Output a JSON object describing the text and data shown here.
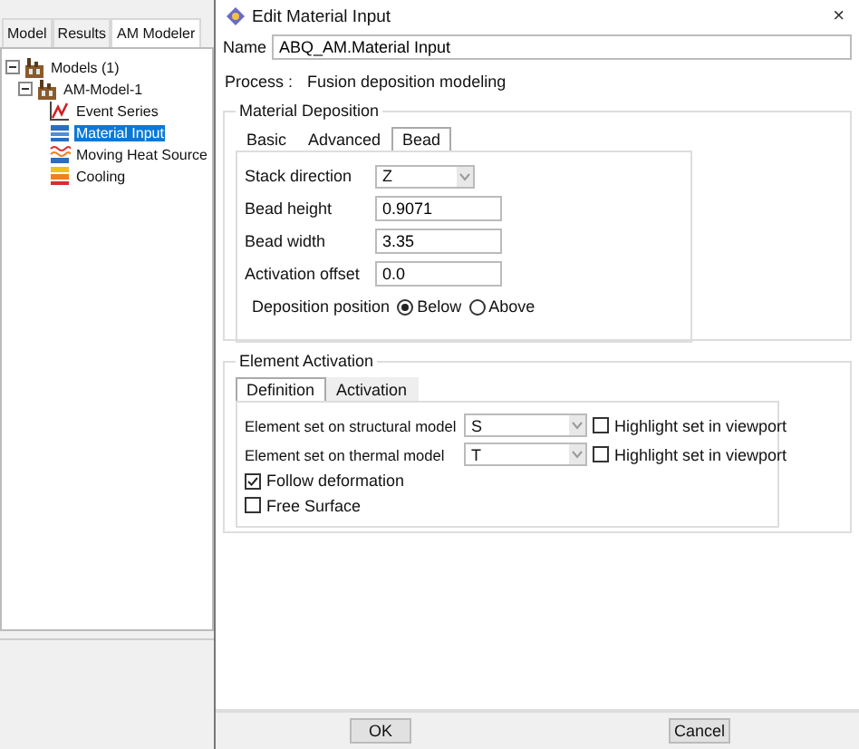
{
  "left_panel": {
    "tabs": [
      {
        "label": "Model",
        "selected": false
      },
      {
        "label": "Results",
        "selected": false
      },
      {
        "label": "AM Modeler",
        "selected": true
      }
    ],
    "tree": [
      {
        "label": "Models (1)",
        "kind": "models",
        "expanded": true,
        "selected": false,
        "children": [
          {
            "label": "AM-Model-1",
            "kind": "model",
            "expanded": true,
            "selected": false,
            "children": [
              {
                "label": "Event Series",
                "kind": "event",
                "selected": false
              },
              {
                "label": "Material Input",
                "kind": "material",
                "selected": true
              },
              {
                "label": "Moving Heat Source",
                "kind": "heat",
                "selected": false
              },
              {
                "label": "Cooling",
                "kind": "cooling",
                "selected": false
              }
            ]
          }
        ]
      }
    ]
  },
  "dialog": {
    "title": "Edit Material Input",
    "close": "×",
    "name_label": "Name",
    "name_value": "ABQ_AM.Material Input",
    "process_label": "Process :",
    "process_value": "Fusion deposition modeling",
    "material_deposition": {
      "title": "Material Deposition",
      "tabs": [
        {
          "label": "Basic",
          "selected": false
        },
        {
          "label": "Advanced",
          "selected": false
        },
        {
          "label": "Bead",
          "selected": true
        }
      ],
      "fields": [
        {
          "kind": "dropdown",
          "label": "Stack direction",
          "value": "Z"
        },
        {
          "kind": "text",
          "label": "Bead height",
          "value": "0.9071"
        },
        {
          "kind": "text",
          "label": "Bead width",
          "value": "3.35"
        },
        {
          "kind": "text",
          "label": "Activation offset",
          "value": "0.0"
        }
      ],
      "deposition_position": {
        "label": "Deposition position",
        "options": [
          {
            "label": "Below",
            "selected": true
          },
          {
            "label": "Above",
            "selected": false
          }
        ]
      }
    },
    "element_activation": {
      "title": "Element Activation",
      "tabs": [
        {
          "label": "Definition",
          "selected": true
        },
        {
          "label": "Activation",
          "selected": false
        }
      ],
      "sets": [
        {
          "label": "Element set on structural model",
          "value": "S",
          "highlight_label": "Highlight set in viewport",
          "highlight_checked": false
        },
        {
          "label": "Element set on thermal model",
          "value": "T",
          "highlight_label": "Highlight set in viewport",
          "highlight_checked": false
        }
      ],
      "options": [
        {
          "label": "Follow deformation",
          "checked": true
        },
        {
          "label": "Free Surface",
          "checked": false
        }
      ]
    },
    "buttons": [
      "OK",
      "Cancel"
    ]
  }
}
